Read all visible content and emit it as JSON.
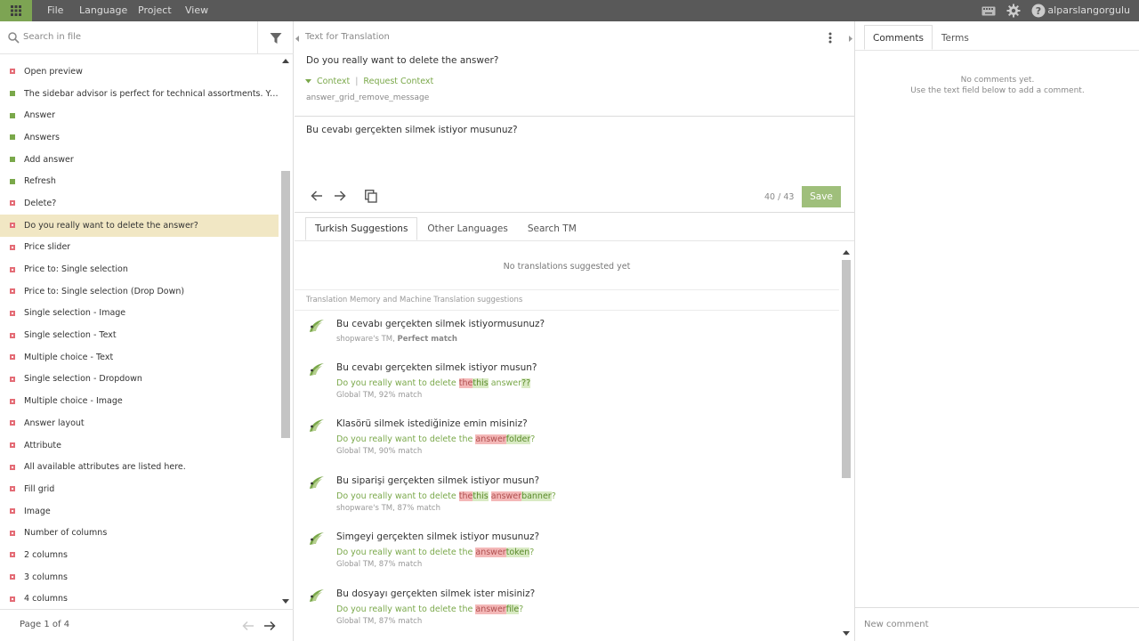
{
  "menu": {
    "file": "File",
    "language": "Language",
    "project": "Project",
    "view": "View"
  },
  "user": {
    "name": "alparslangorgulu"
  },
  "left": {
    "search_placeholder": "Search in file",
    "items": [
      {
        "label": "Open preview",
        "status": "red"
      },
      {
        "label": "The sidebar advisor is perfect for technical assortments. You ca...",
        "status": "green"
      },
      {
        "label": "Answer",
        "status": "green"
      },
      {
        "label": "Answers",
        "status": "green"
      },
      {
        "label": "Add answer",
        "status": "green"
      },
      {
        "label": "Refresh",
        "status": "green"
      },
      {
        "label": "Delete?",
        "status": "red"
      },
      {
        "label": "Do you really want to delete the answer?",
        "status": "red",
        "selected": true
      },
      {
        "label": "Price slider",
        "status": "red"
      },
      {
        "label": "Price to: Single selection",
        "status": "red"
      },
      {
        "label": "Price to: Single selection (Drop Down)",
        "status": "red"
      },
      {
        "label": "Single selection - Image",
        "status": "red"
      },
      {
        "label": "Single selection - Text",
        "status": "red"
      },
      {
        "label": "Multiple choice - Text",
        "status": "red"
      },
      {
        "label": "Single selection - Dropdown",
        "status": "red"
      },
      {
        "label": "Multiple choice - Image",
        "status": "red"
      },
      {
        "label": "Answer layout",
        "status": "red"
      },
      {
        "label": "Attribute",
        "status": "red"
      },
      {
        "label": "All available attributes are listed here.",
        "status": "red"
      },
      {
        "label": "Fill grid",
        "status": "red"
      },
      {
        "label": "Image",
        "status": "red"
      },
      {
        "label": "Number of columns",
        "status": "red"
      },
      {
        "label": "2 columns",
        "status": "red"
      },
      {
        "label": "3 columns",
        "status": "red"
      },
      {
        "label": "4 columns",
        "status": "red"
      }
    ],
    "pager_label": "Page 1 of 4"
  },
  "editor": {
    "source_header": "Text for Translation",
    "source_text": "Do you really want to delete the answer?",
    "context_label": "Context",
    "context_sep": "|",
    "request_context_label": "Request Context",
    "key": "answer_grid_remove_message",
    "target_text": "Bu cevabı gerçekten silmek istiyor musunuz?",
    "counter": "40 / 43",
    "save_label": "Save",
    "tabs": [
      "Turkish Suggestions",
      "Other Languages",
      "Search TM"
    ],
    "no_suggestions": "No translations suggested yet",
    "tm_header": "Translation Memory and Machine Translation suggestions",
    "suggestions": [
      {
        "translation": "Bu cevabı gerçekten silmek istiyormusunuz?",
        "meta_source": "shopware's TM, ",
        "meta_match": "Perfect match"
      },
      {
        "translation": "Bu cevabı gerçekten silmek istiyor musun?",
        "diff": [
          {
            "t": "Do you really want to delete ",
            "k": "plain"
          },
          {
            "t": "the",
            "k": "del"
          },
          {
            "t": "this",
            "k": "ins"
          },
          {
            "t": " answer",
            "k": "plain"
          },
          {
            "t": "??",
            "k": "ins"
          }
        ],
        "meta": "Global TM, 92% match"
      },
      {
        "translation": "Klasörü silmek istediğinize emin misiniz?",
        "diff": [
          {
            "t": "Do you really want to delete the ",
            "k": "plain"
          },
          {
            "t": "answer",
            "k": "del"
          },
          {
            "t": "folder",
            "k": "ins"
          },
          {
            "t": "?",
            "k": "plain"
          }
        ],
        "meta": "Global TM, 90% match"
      },
      {
        "translation": "Bu siparişi gerçekten silmek istiyor musun?",
        "diff": [
          {
            "t": "Do you really want to delete ",
            "k": "plain"
          },
          {
            "t": "the",
            "k": "del"
          },
          {
            "t": "this",
            "k": "ins"
          },
          {
            "t": " ",
            "k": "plain"
          },
          {
            "t": "answer",
            "k": "del"
          },
          {
            "t": "banner",
            "k": "ins"
          },
          {
            "t": "?",
            "k": "plain"
          }
        ],
        "meta": "shopware's TM, 87% match"
      },
      {
        "translation": "Simgeyi gerçekten silmek istiyor musunuz?",
        "diff": [
          {
            "t": "Do you really want to delete the ",
            "k": "plain"
          },
          {
            "t": "answer",
            "k": "del"
          },
          {
            "t": "token",
            "k": "ins"
          },
          {
            "t": "?",
            "k": "plain"
          }
        ],
        "meta": "Global TM, 87% match"
      },
      {
        "translation": "Bu dosyayı gerçekten silmek ister misiniz?",
        "diff": [
          {
            "t": "Do you really want to delete the ",
            "k": "plain"
          },
          {
            "t": "answer",
            "k": "del"
          },
          {
            "t": "file",
            "k": "ins"
          },
          {
            "t": "?",
            "k": "plain"
          }
        ],
        "meta": "Global TM, 87% match"
      }
    ]
  },
  "right": {
    "tabs": [
      "Comments",
      "Terms"
    ],
    "no_comments_line1": "No comments yet.",
    "no_comments_line2": "Use the text field below to add a comment.",
    "new_comment_placeholder": "New comment"
  },
  "colors": {
    "accent": "#7aa84a",
    "topbar": "#595959",
    "selected_row": "#f1e7c4",
    "save": "#9fbf7b"
  },
  "icons": [
    "apps-grid-icon",
    "keyboard-icon",
    "gear-icon",
    "help-icon",
    "search-icon",
    "filter-icon",
    "more-vert-icon",
    "arrow-left-icon",
    "arrow-right-icon",
    "copy-source-icon",
    "tm-logo-icon"
  ]
}
